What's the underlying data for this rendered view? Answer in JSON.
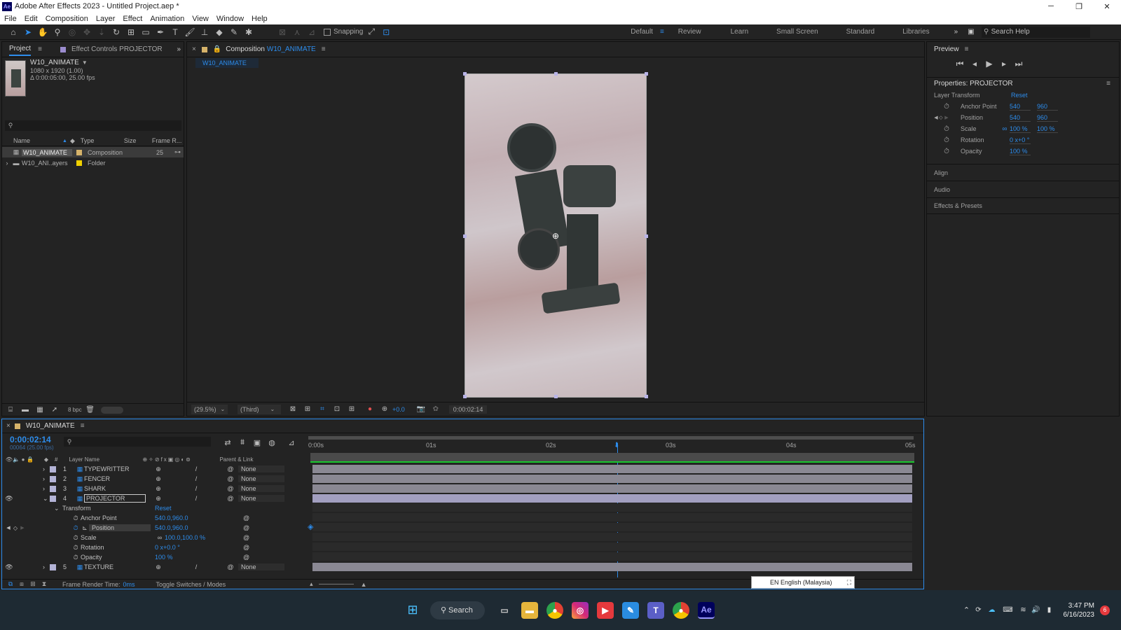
{
  "window": {
    "title": "Adobe After Effects 2023 - Untitled Project.aep *",
    "app_icon": "Ae"
  },
  "menu": [
    "File",
    "Edit",
    "Composition",
    "Layer",
    "Effect",
    "Animation",
    "View",
    "Window",
    "Help"
  ],
  "toolbar": {
    "snapping_label": "Snapping",
    "workspaces": [
      "Default",
      "Review",
      "Learn",
      "Small Screen",
      "Standard",
      "Libraries"
    ],
    "active_workspace": "Default",
    "search_placeholder": "Search Help"
  },
  "project_panel": {
    "tab_project": "Project",
    "tab_effect_controls": "Effect Controls PROJECTOR",
    "comp_name": "W10_ANIMATE",
    "comp_dims": "1080 x 1920 (1.00)",
    "comp_duration": "Δ 0:00:05:00, 25.00 fps",
    "columns": {
      "name": "Name",
      "type": "Type",
      "size": "Size",
      "frame_rate": "Frame R..."
    },
    "items": [
      {
        "name": "W10_ANIMATE",
        "type": "Composition",
        "frame_rate": "25",
        "color": "#e0c070"
      },
      {
        "name": "W10_ANI..ayers",
        "type": "Folder",
        "frame_rate": "",
        "color": "#f0d000"
      }
    ],
    "bpc": "8 bpc"
  },
  "composition_panel": {
    "tab_label": "Composition",
    "tab_comp": "W10_ANIMATE",
    "sub_tab": "W10_ANIMATE",
    "zoom": "(29.5%)",
    "resolution": "(Third)",
    "exposure": "+0.0",
    "timecode": "0:00:02:14"
  },
  "preview_panel": {
    "title": "Preview"
  },
  "properties_panel": {
    "title": "Properties: PROJECTOR",
    "section": "Layer Transform",
    "reset": "Reset",
    "props": [
      {
        "name": "Anchor Point",
        "v1": "540",
        "v2": "960"
      },
      {
        "name": "Position",
        "v1": "540",
        "v2": "960"
      },
      {
        "name": "Scale",
        "v1": "100 %",
        "v2": "100 %"
      },
      {
        "name": "Rotation",
        "v1": "0 x+0 °",
        "v2": ""
      },
      {
        "name": "Opacity",
        "v1": "100 %",
        "v2": ""
      }
    ],
    "sections": [
      "Align",
      "Audio",
      "Effects & Presets"
    ]
  },
  "timeline": {
    "comp_tab": "W10_ANIMATE",
    "timecode": "0:00:02:14",
    "frames": "00064 (25.00 fps)",
    "col_layer_name": "Layer Name",
    "col_parent": "Parent & Link",
    "ruler": [
      "0:00s",
      "01s",
      "02s",
      "03s",
      "04s",
      "05s"
    ],
    "layers": [
      {
        "num": "1",
        "name": "TYPEWRITTER",
        "parent": "None"
      },
      {
        "num": "2",
        "name": "FENCER",
        "parent": "None"
      },
      {
        "num": "3",
        "name": "SHARK",
        "parent": "None"
      },
      {
        "num": "4",
        "name": "PROJECTOR",
        "parent": "None"
      },
      {
        "num": "5",
        "name": "TEXTURE",
        "parent": "None"
      }
    ],
    "transform": {
      "label": "Transform",
      "reset": "Reset",
      "props": [
        {
          "name": "Anchor Point",
          "value": "540.0,960.0"
        },
        {
          "name": "Position",
          "value": "540.0,960.0"
        },
        {
          "name": "Scale",
          "value": "100.0,100.0 %"
        },
        {
          "name": "Rotation",
          "value": "0 x+0.0 °"
        },
        {
          "name": "Opacity",
          "value": "100 %"
        }
      ]
    },
    "footer_render_label": "Frame Render Time:",
    "footer_render_value": "0ms",
    "footer_toggle": "Toggle Switches / Modes"
  },
  "language_popup": "EN English (Malaysia)",
  "taskbar": {
    "search": "Search",
    "time": "3:47 PM",
    "date": "6/16/2023",
    "notif_count": "6"
  }
}
